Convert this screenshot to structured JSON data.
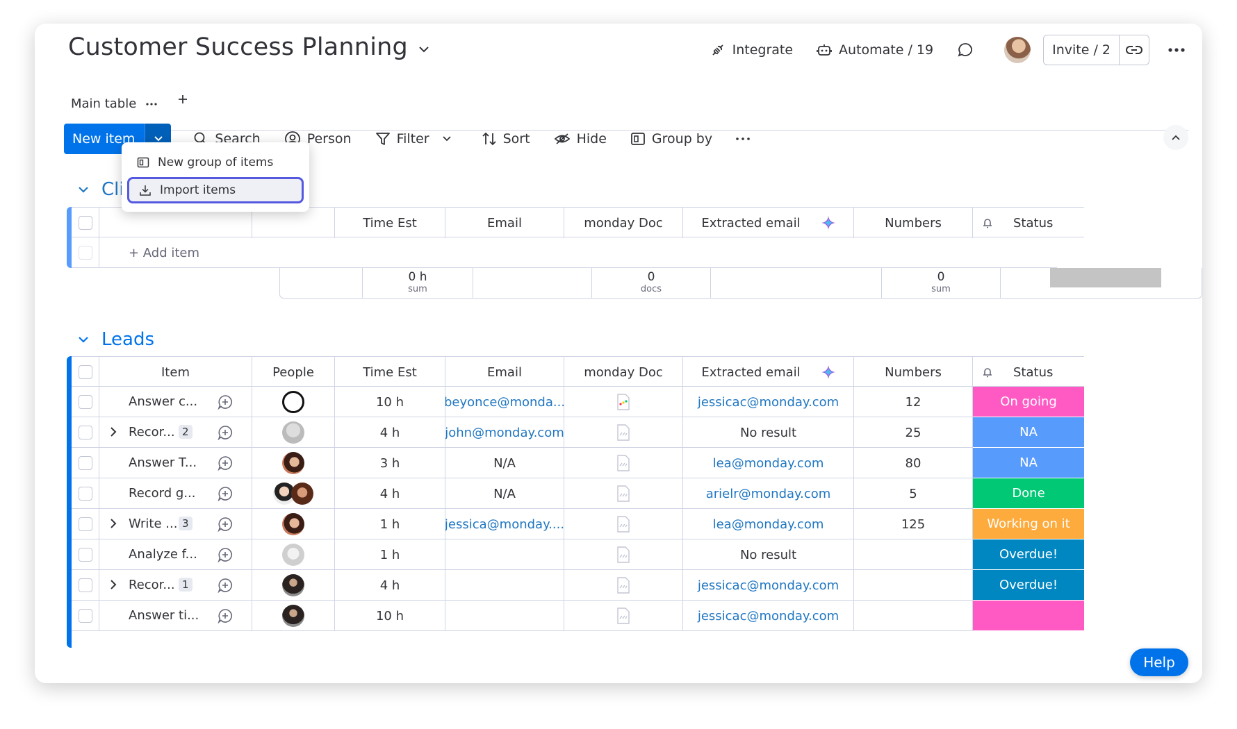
{
  "board": {
    "title": "Customer Success Planning",
    "tabs": [
      {
        "label": "Main table"
      }
    ],
    "actions": {
      "integrate": "Integrate",
      "automate": "Automate / 19",
      "invite": "Invite / 2"
    }
  },
  "toolbar": {
    "new_item": "New item",
    "search": "Search",
    "person": "Person",
    "filter": "Filter",
    "sort": "Sort",
    "hide": "Hide",
    "group_by": "Group by"
  },
  "dropdown": {
    "items": [
      "New group of items",
      "Import items"
    ],
    "selected": "Import items"
  },
  "columns": [
    "Item",
    "People",
    "Time Est",
    "Email",
    "monday Doc",
    "Extracted email",
    "Numbers",
    "Status"
  ],
  "groups": [
    {
      "name": "Clie",
      "color": "#579bfc",
      "add_item": "+ Add item",
      "summary": {
        "time": "0 h",
        "time_label": "sum",
        "docs": "0",
        "docs_label": "docs",
        "numbers": "0",
        "numbers_label": "sum"
      }
    },
    {
      "name": "Leads",
      "color": "#0073ea",
      "rows": [
        {
          "item": "Answer c...",
          "subitems": "",
          "people": "avatar-generic",
          "time": "10 h",
          "email": "beyonce@monda...",
          "doc": "doc-filled",
          "extracted": "jessicac@monday.com",
          "number": "12",
          "status": "On going",
          "status_color": "#ff5ac4"
        },
        {
          "item": "Recor...",
          "subitems": "2",
          "people": "avatar-gray",
          "time": "4 h",
          "email": "john@monday.com",
          "doc": "doc-empty",
          "extracted": "No result",
          "number": "25",
          "status": "NA",
          "status_color": "#579bfc"
        },
        {
          "item": "Answer T...",
          "subitems": "",
          "people": "avatar-woman",
          "time": "3 h",
          "email": "N/A",
          "doc": "doc-empty",
          "extracted": "lea@monday.com",
          "number": "80",
          "status": "NA",
          "status_color": "#579bfc"
        },
        {
          "item": "Record g...",
          "subitems": "",
          "people": "avatar-pair",
          "time": "4 h",
          "email": "N/A",
          "doc": "doc-empty",
          "extracted": "arielr@monday.com",
          "number": "5",
          "status": "Done",
          "status_color": "#00c875"
        },
        {
          "item": "Write ...",
          "subitems": "3",
          "people": "avatar-woman",
          "time": "1 h",
          "email": "jessica@monday....",
          "doc": "doc-empty",
          "extracted": "lea@monday.com",
          "number": "125",
          "status": "Working on it",
          "status_color": "#fdab3d"
        },
        {
          "item": "Analyze f...",
          "subitems": "",
          "people": "avatar-light",
          "time": "1 h",
          "email": "",
          "doc": "doc-empty",
          "extracted": "No result",
          "number": "",
          "status": "Overdue!",
          "status_color": "#0086c0"
        },
        {
          "item": "Recor...",
          "subitems": "1",
          "people": "avatar-dark",
          "time": "4 h",
          "email": "",
          "doc": "doc-empty",
          "extracted": "jessicac@monday.com",
          "number": "",
          "status": "Overdue!",
          "status_color": "#0086c0"
        },
        {
          "item": "Answer ti...",
          "subitems": "",
          "people": "avatar-dark",
          "time": "10 h",
          "email": "",
          "doc": "doc-empty",
          "extracted": "jessicac@monday.com",
          "number": "",
          "status": "",
          "status_color": "#ff5ac4"
        }
      ]
    }
  ],
  "help": "Help"
}
